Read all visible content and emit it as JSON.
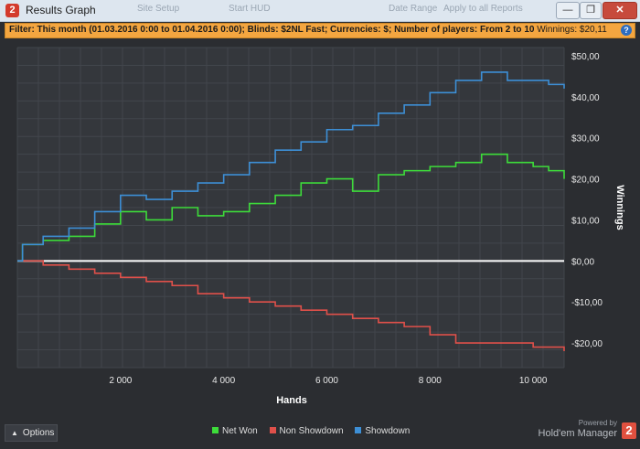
{
  "window": {
    "title": "Results Graph",
    "app_icon_text": "2",
    "background_tabs": [
      "Site Setup",
      "Start HUD",
      "Date Range",
      "Apply to all Reports"
    ],
    "buttons": {
      "minimize": "—",
      "restore": "❐",
      "close": "✕"
    }
  },
  "filter": {
    "text": "Filter: This month (01.03.2016 0:00 to 01.04.2016 0:00); Blinds: $2NL Fast; Currencies: $; Number of players: From 2 to 10",
    "winnings_text": "Winnings: $20,11",
    "help_icon": "?"
  },
  "chart_data": {
    "type": "line",
    "title": "",
    "xlabel": "Hands",
    "ylabel": "Winnings",
    "xlim": [
      0,
      10600
    ],
    "ylim": [
      -26,
      52
    ],
    "x_ticks": [
      2000,
      4000,
      6000,
      8000,
      10000
    ],
    "x_tick_labels": [
      "2 000",
      "4 000",
      "6 000",
      "8 000",
      "10 000"
    ],
    "y_ticks": [
      50,
      40,
      30,
      20,
      10,
      0,
      -10,
      -20
    ],
    "y_tick_labels": [
      "$50,00",
      "$40,00",
      "$30,00",
      "$20,00",
      "$10,00",
      "$0,00",
      "-$10,00",
      "-$20,00"
    ],
    "grid": true,
    "legend_position": "bottom",
    "x": [
      0,
      100,
      500,
      1000,
      1500,
      2000,
      2500,
      3000,
      3500,
      4000,
      4500,
      5000,
      5500,
      6000,
      6500,
      7000,
      7500,
      8000,
      8500,
      9000,
      9500,
      10000,
      10300,
      10600
    ],
    "series": [
      {
        "name": "Net Won",
        "color": "#3ddc3a",
        "values": [
          0,
          4,
          5,
          6,
          9,
          12,
          10,
          13,
          11,
          12,
          14,
          16,
          19,
          20,
          17,
          21,
          22,
          23,
          24,
          26,
          24,
          23,
          22,
          20
        ]
      },
      {
        "name": "Non Showdown",
        "color": "#e0504a",
        "values": [
          0,
          0,
          -1,
          -2,
          -3,
          -4,
          -5,
          -6,
          -8,
          -9,
          -10,
          -11,
          -12,
          -13,
          -14,
          -15,
          -16,
          -18,
          -20,
          -20,
          -20,
          -21,
          -21,
          -22
        ]
      },
      {
        "name": "Showdown",
        "color": "#3d8fd6",
        "values": [
          0,
          4,
          6,
          8,
          12,
          16,
          15,
          17,
          19,
          21,
          24,
          27,
          29,
          32,
          33,
          36,
          38,
          41,
          44,
          46,
          44,
          44,
          43,
          42
        ]
      }
    ]
  },
  "footer": {
    "options_label": "Options",
    "options_icon": "chevron-up-icon",
    "powered_by": "Powered by",
    "brand_name": "Hold'em Manager",
    "brand_logo_text": "2"
  }
}
